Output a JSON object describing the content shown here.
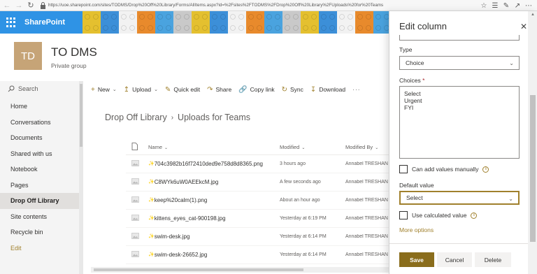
{
  "browser": {
    "url": "https://uoe.sharepoint.com/sites/TODMS/Drop%20Off%20Library/Forms/AllItems.aspx?id=%2Fsites%2FTODMS%2FDrop%20Off%20Library%2FUploads%20for%20Teams"
  },
  "suite": {
    "title": "SharePoint"
  },
  "site": {
    "logo_text": "TD",
    "title": "TO DMS",
    "subtitle": "Private group"
  },
  "left_nav": {
    "search_placeholder": "Search",
    "items": [
      {
        "label": "Home"
      },
      {
        "label": "Conversations"
      },
      {
        "label": "Documents"
      },
      {
        "label": "Shared with us"
      },
      {
        "label": "Notebook"
      },
      {
        "label": "Pages"
      },
      {
        "label": "Drop Off Library"
      },
      {
        "label": "Site contents"
      },
      {
        "label": "Recycle bin"
      },
      {
        "label": "Edit"
      }
    ]
  },
  "command_bar": {
    "new": "New",
    "upload": "Upload",
    "quick_edit": "Quick edit",
    "share": "Share",
    "copy_link": "Copy link",
    "sync": "Sync",
    "download": "Download",
    "more": "···"
  },
  "breadcrumb": {
    "parent": "Drop Off Library",
    "current": "Uploads for Teams"
  },
  "table": {
    "headers": {
      "name": "Name",
      "modified": "Modified",
      "modified_by": "Modified By"
    },
    "rows": [
      {
        "name": "704c3982b16f72410ded9e758d8d8365.png",
        "modified": "3 hours ago",
        "modified_by": "Annabel TRESHAN"
      },
      {
        "name": "C8WYk6uW0AEEkcM.jpg",
        "modified": "A few seconds ago",
        "modified_by": "Annabel TRESHAN"
      },
      {
        "name": "keep%20calm(1).png",
        "modified": "About an hour ago",
        "modified_by": "Annabel TRESHAN"
      },
      {
        "name": "kittens_eyes_cat-900198.jpg",
        "modified": "Yesterday at 6:19 PM",
        "modified_by": "Annabel TRESHAN"
      },
      {
        "name": "swim-desk.jpg",
        "modified": "Yesterday at 6:14 PM",
        "modified_by": "Annabel TRESHAN"
      },
      {
        "name": "swim-desk-26652.jpg",
        "modified": "Yesterday at 6:14 PM",
        "modified_by": "Annabel TRESHAN"
      }
    ]
  },
  "panel": {
    "title": "Edit column",
    "type_label": "Type",
    "type_value": "Choice",
    "choices_label": "Choices",
    "required_mark": "*",
    "choices": [
      "Select",
      "Urgent",
      "FYI"
    ],
    "manual_label": "Can add values manually",
    "default_label": "Default value",
    "default_value": "Select",
    "calculated_label": "Use calculated value",
    "more_options": "More options",
    "save": "Save",
    "cancel": "Cancel",
    "delete": "Delete"
  },
  "colors": {
    "accent": "#a0802c",
    "suite_blue": "#2f93e5",
    "logo": "#c6a477",
    "save": "#8a6d1c"
  }
}
